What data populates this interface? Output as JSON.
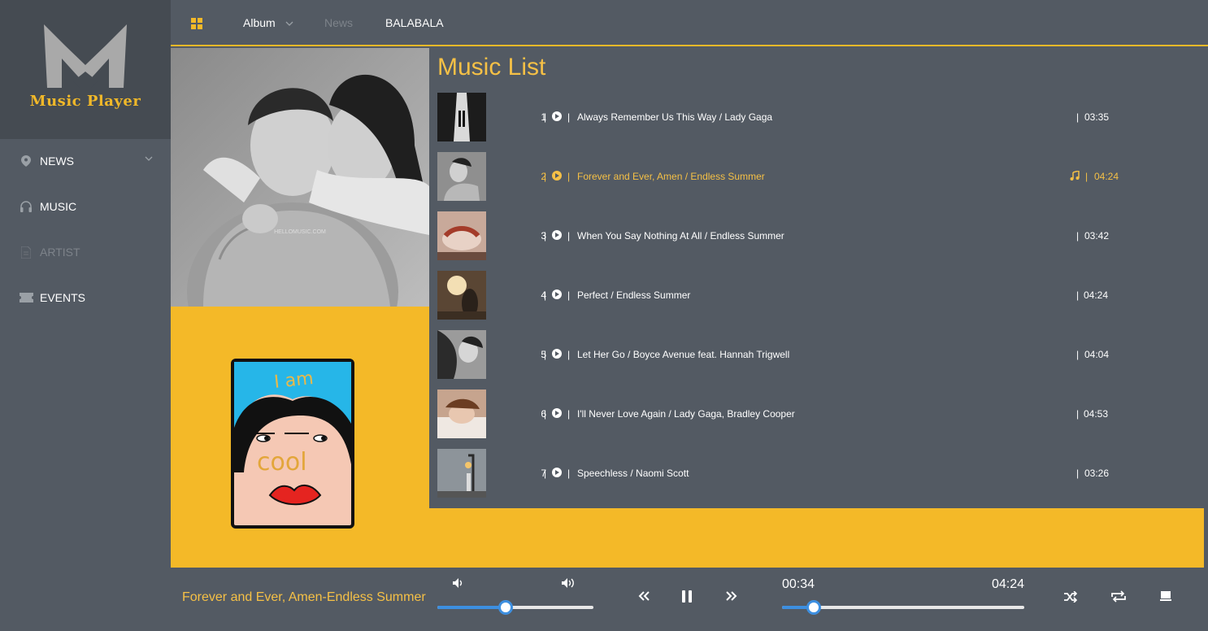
{
  "sidebar": {
    "logo_text": "Music Player",
    "items": [
      {
        "label": "NEWS",
        "icon": "location-pin-icon",
        "disabled": false
      },
      {
        "label": "MUSIC",
        "icon": "headphones-icon",
        "disabled": false
      },
      {
        "label": "ARTIST",
        "icon": "document-icon",
        "disabled": true
      },
      {
        "label": "EVENTS",
        "icon": "ticket-icon",
        "disabled": false
      }
    ]
  },
  "topbar": {
    "menu_icon": "grid-icon",
    "links": [
      {
        "label": "Album",
        "has_dropdown": true
      },
      {
        "label": "News",
        "disabled": true
      },
      {
        "label": "BALABALA"
      }
    ]
  },
  "artwork": {
    "photo_watermark": "HELLOMUSIC.COM",
    "poster_text_top": "I am",
    "poster_text_face": "cool"
  },
  "music_list": {
    "title": "Music List",
    "tracks": [
      {
        "num": "1",
        "title": "Always Remember Us This Way / Lady Gaga",
        "duration": "03:35"
      },
      {
        "num": "2",
        "title": "Forever and Ever, Amen / Endless Summer",
        "duration": "04:24",
        "playing": true
      },
      {
        "num": "3",
        "title": "When You Say Nothing At All / Endless Summer",
        "duration": "03:42"
      },
      {
        "num": "4",
        "title": "Perfect / Endless Summer",
        "duration": "04:24"
      },
      {
        "num": "5",
        "title": "Let Her Go / Boyce Avenue feat. Hannah Trigwell",
        "duration": "04:04"
      },
      {
        "num": "6",
        "title": "I'll Never Love Again / Lady Gaga, Bradley Cooper",
        "duration": "04:53"
      },
      {
        "num": "7",
        "title": "Speechless / Naomi Scott",
        "duration": "03:26"
      }
    ]
  },
  "player": {
    "now_playing": "Forever and Ever, Amen-Endless Summer",
    "volume_percent": 44,
    "current_time": "00:34",
    "total_time": "04:24",
    "progress_fraction": 0.13,
    "accent_color": "#f4b928",
    "slider_color": "#3d8fe0"
  }
}
